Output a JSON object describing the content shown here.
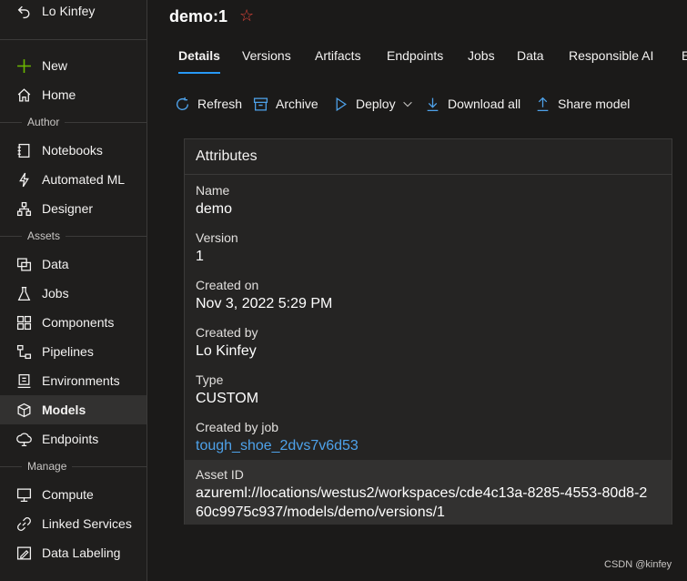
{
  "sidebar": {
    "user": "Lo Kinfey",
    "top_items": [
      {
        "label": "New",
        "icon": "plus-icon"
      },
      {
        "label": "Home",
        "icon": "home-icon"
      }
    ],
    "groups": [
      {
        "title": "Author",
        "items": [
          {
            "label": "Notebooks",
            "icon": "notebook-icon"
          },
          {
            "label": "Automated ML",
            "icon": "automated-ml-icon"
          },
          {
            "label": "Designer",
            "icon": "designer-icon"
          }
        ]
      },
      {
        "title": "Assets",
        "items": [
          {
            "label": "Data",
            "icon": "data-icon"
          },
          {
            "label": "Jobs",
            "icon": "flask-icon"
          },
          {
            "label": "Components",
            "icon": "components-icon"
          },
          {
            "label": "Pipelines",
            "icon": "pipelines-icon"
          },
          {
            "label": "Environments",
            "icon": "environments-icon"
          },
          {
            "label": "Models",
            "icon": "cube-icon",
            "selected": true
          },
          {
            "label": "Endpoints",
            "icon": "endpoints-icon"
          }
        ]
      },
      {
        "title": "Manage",
        "items": [
          {
            "label": "Compute",
            "icon": "monitor-icon"
          },
          {
            "label": "Linked Services",
            "icon": "link-icon"
          },
          {
            "label": "Data Labeling",
            "icon": "labeling-icon"
          }
        ]
      }
    ]
  },
  "header": {
    "title": "demo:1",
    "favorite_icon": "star-icon"
  },
  "tabs": [
    "Details",
    "Versions",
    "Artifacts",
    "Endpoints",
    "Jobs",
    "Data",
    "Responsible AI",
    "E"
  ],
  "toolbar": {
    "refresh": "Refresh",
    "archive": "Archive",
    "deploy": "Deploy",
    "download_all": "Download all",
    "share_model": "Share model"
  },
  "attributes": {
    "title": "Attributes",
    "fields": [
      {
        "label": "Name",
        "value": "demo"
      },
      {
        "label": "Version",
        "value": "1"
      },
      {
        "label": "Created on",
        "value": "Nov 3, 2022 5:29 PM"
      },
      {
        "label": "Created by",
        "value": "Lo Kinfey"
      },
      {
        "label": "Type",
        "value": "CUSTOM"
      },
      {
        "label": "Created by job",
        "value": "tough_shoe_2dvs7v6d53"
      },
      {
        "label": "Asset ID",
        "value": "azureml://locations/westus2/workspaces/cde4c13a-8285-4553-80d8-260c9975c937/models/demo/versions/1"
      }
    ]
  },
  "watermark": "CSDN @kinfey",
  "colors": {
    "accent": "#2899f5",
    "link": "#4ea2ea",
    "star": "#e0443a",
    "new_plus": "#6bb700"
  }
}
